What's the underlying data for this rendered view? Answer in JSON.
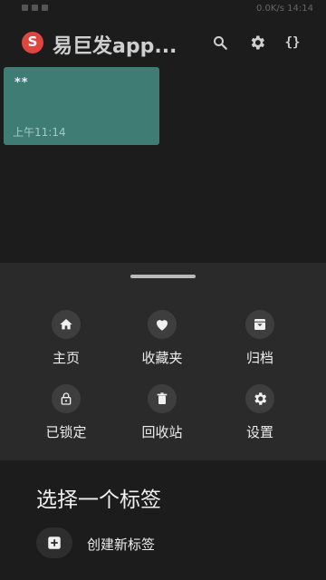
{
  "statusbar": {
    "right_text": "0.0K/s  14:14"
  },
  "app": {
    "title": "易巨发app...",
    "logo_icon": "app-logo-icon"
  },
  "toolbar": {
    "search_icon": "search-icon",
    "settings_icon": "gear-icon",
    "code_icon_text": "{}"
  },
  "note": {
    "title": "**",
    "time": "上午11:14",
    "color": "#3f7c74"
  },
  "sheet": {
    "items": [
      {
        "label": "主页",
        "icon": "home-icon"
      },
      {
        "label": "收藏夹",
        "icon": "heart-icon"
      },
      {
        "label": "归档",
        "icon": "archive-icon"
      },
      {
        "label": "已锁定",
        "icon": "lock-icon"
      },
      {
        "label": "回收站",
        "icon": "trash-icon"
      },
      {
        "label": "设置",
        "icon": "gear-icon"
      }
    ]
  },
  "panel": {
    "title": "选择一个标签",
    "create_label": "创建新标签",
    "create_icon": "add-box-icon"
  }
}
